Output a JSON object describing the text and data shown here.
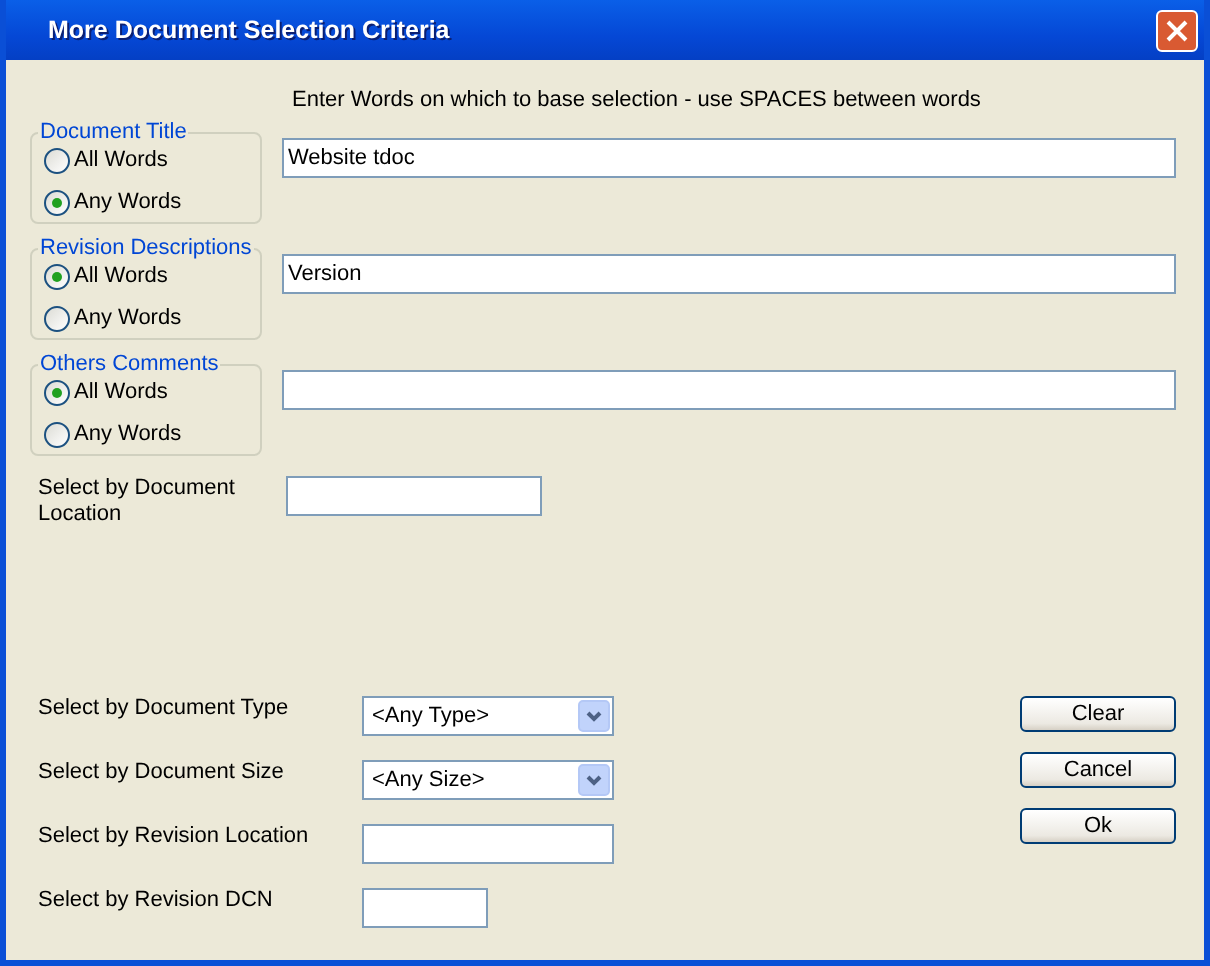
{
  "window": {
    "title": "More Document Selection Criteria"
  },
  "instruction": "Enter Words on which to base selection - use SPACES between words",
  "criteria": [
    {
      "label": "Document Title",
      "value": "Website tdoc",
      "options": [
        {
          "label": "All Words",
          "selected": false
        },
        {
          "label": "Any Words",
          "selected": true
        }
      ]
    },
    {
      "label": "Revision Descriptions",
      "value": "Version",
      "options": [
        {
          "label": "All Words",
          "selected": true
        },
        {
          "label": "Any Words",
          "selected": false
        }
      ]
    },
    {
      "label": "Others Comments",
      "options": [
        {
          "label": "All Words",
          "selected": true
        },
        {
          "label": "Any Words",
          "selected": false
        }
      ]
    }
  ],
  "location": {
    "label": "Select by Document Location"
  },
  "filters": [
    {
      "kind": "dropdown",
      "label": "Select by Document Type",
      "value": "<Any Type>"
    },
    {
      "kind": "dropdown",
      "label": "Select by Document Size",
      "value": "<Any Size>"
    },
    {
      "kind": "text",
      "label": "Select by Revision Location"
    },
    {
      "kind": "short-text",
      "label": "Select by Revision DCN"
    }
  ],
  "buttons": [
    "Clear",
    "Cancel",
    "Ok"
  ]
}
